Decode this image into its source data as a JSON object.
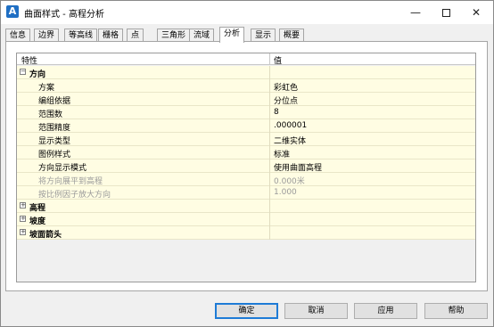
{
  "window": {
    "title": "曲面样式 - 高程分析",
    "app_icon_letter": "A",
    "minimize_glyph": "—",
    "close_glyph": "✕"
  },
  "tabs": [
    {
      "label": "信息",
      "active": false
    },
    {
      "label": "边界",
      "active": false
    },
    {
      "label": "等高线",
      "active": false
    },
    {
      "label": "栅格",
      "active": false
    },
    {
      "label": "点",
      "active": false
    },
    {
      "label": "三角形",
      "active": false
    },
    {
      "label": "流域",
      "active": false
    },
    {
      "label": "分析",
      "active": true
    },
    {
      "label": "显示",
      "active": false
    },
    {
      "label": "概要",
      "active": false
    }
  ],
  "grid": {
    "col_property": "特性",
    "col_value": "值",
    "expand_glyph_open": "⊟",
    "expand_glyph_closed": "⊞",
    "groups": [
      {
        "name": "方向",
        "expanded": true,
        "rows": [
          {
            "name": "方案",
            "value": "彩虹色",
            "disabled": false
          },
          {
            "name": "编组依据",
            "value": "分位点",
            "disabled": false
          },
          {
            "name": "范围数",
            "value": "8",
            "disabled": false
          },
          {
            "name": "范围精度",
            "value": ".000001",
            "disabled": false
          },
          {
            "name": "显示类型",
            "value": "二维实体",
            "disabled": false
          },
          {
            "name": "图例样式",
            "value": "标准",
            "disabled": false
          },
          {
            "name": "方向显示模式",
            "value": "使用曲面高程",
            "disabled": false
          },
          {
            "name": "将方向展平到高程",
            "value": "0.000米",
            "disabled": true
          },
          {
            "name": "按比例因子放大方向",
            "value": "1.000",
            "disabled": true
          }
        ]
      },
      {
        "name": "高程",
        "expanded": false,
        "rows": []
      },
      {
        "name": "坡度",
        "expanded": false,
        "rows": []
      },
      {
        "name": "坡面箭头",
        "expanded": false,
        "rows": []
      }
    ]
  },
  "buttons": {
    "ok": "确定",
    "cancel": "取消",
    "apply": "应用",
    "help": "帮助"
  },
  "colors": {
    "row_bg": "#fffde3",
    "accent": "#1e7bd6",
    "disabled_text": "#9a9a9a"
  }
}
